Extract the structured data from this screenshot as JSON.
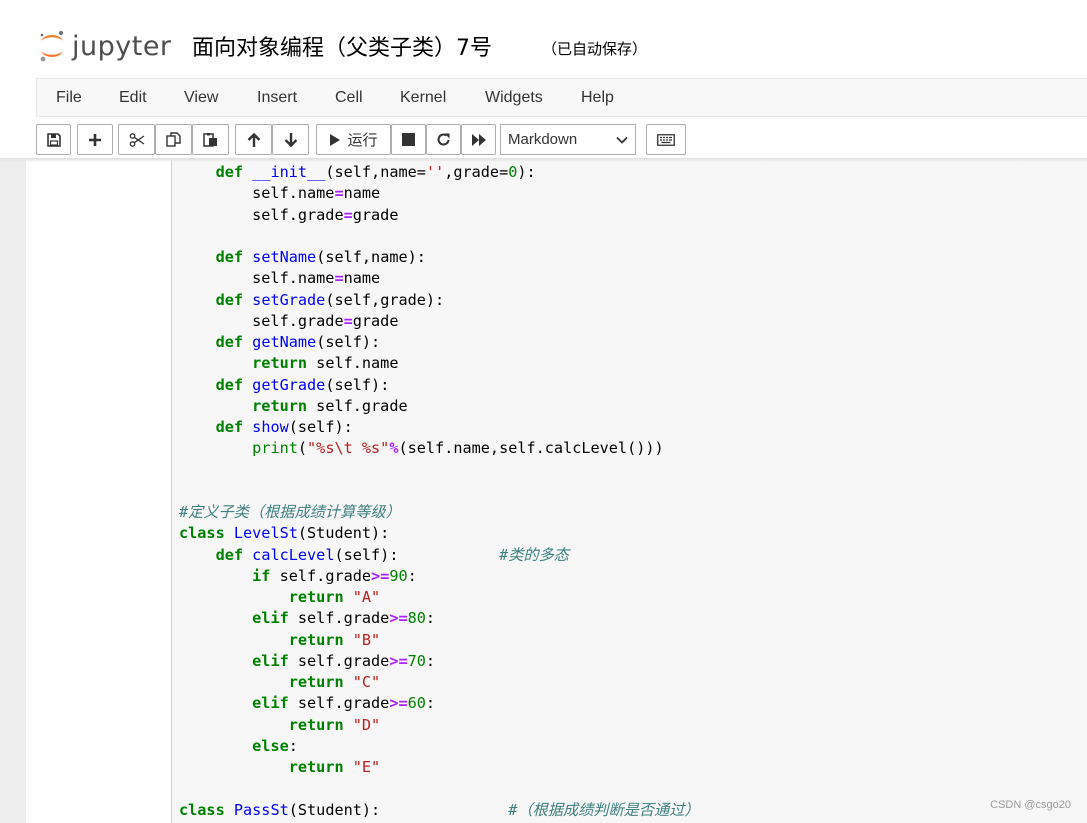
{
  "app": {
    "logo_text": "jupyter",
    "notebook_title": "面向对象编程（父类子类）7号",
    "save_status": "（已自动保存）"
  },
  "menu": [
    "File",
    "Edit",
    "View",
    "Insert",
    "Cell",
    "Kernel",
    "Widgets",
    "Help"
  ],
  "toolbar": {
    "run_label": "运行",
    "cell_type": "Markdown",
    "buttons": [
      "save-icon",
      "plus-icon",
      "cut-icon",
      "copy-icon",
      "paste-icon",
      "arrow-up-icon",
      "arrow-down-icon",
      "play-icon",
      "stop-icon",
      "restart-icon",
      "fast-forward-icon",
      "keyboard-icon"
    ]
  },
  "colors": {
    "logo_orange": "#f37626",
    "keyword": "#008000",
    "function_name": "#0000ff",
    "operator": "#aa22ff",
    "string": "#ba2121",
    "comment": "#408080"
  },
  "code": [
    [
      [
        "    ",
        ""
      ],
      [
        "def",
        "kw"
      ],
      [
        " ",
        ""
      ],
      [
        "__init__",
        "def"
      ],
      [
        "(self,name=",
        ""
      ],
      [
        "''",
        "str"
      ],
      [
        ",grade=",
        ""
      ],
      [
        "0",
        "num"
      ],
      [
        "):",
        ""
      ]
    ],
    [
      [
        "        self.name",
        ""
      ],
      [
        "=",
        "op"
      ],
      [
        "name",
        ""
      ]
    ],
    [
      [
        "        self.grade",
        ""
      ],
      [
        "=",
        "op"
      ],
      [
        "grade",
        ""
      ]
    ],
    [],
    [
      [
        "    ",
        ""
      ],
      [
        "def",
        "kw"
      ],
      [
        " ",
        ""
      ],
      [
        "setName",
        "def"
      ],
      [
        "(self,name):",
        ""
      ]
    ],
    [
      [
        "        self.name",
        ""
      ],
      [
        "=",
        "op"
      ],
      [
        "name",
        ""
      ]
    ],
    [
      [
        "    ",
        ""
      ],
      [
        "def",
        "kw"
      ],
      [
        " ",
        ""
      ],
      [
        "setGrade",
        "def"
      ],
      [
        "(self,grade):",
        ""
      ]
    ],
    [
      [
        "        self.grade",
        ""
      ],
      [
        "=",
        "op"
      ],
      [
        "grade",
        ""
      ]
    ],
    [
      [
        "    ",
        ""
      ],
      [
        "def",
        "kw"
      ],
      [
        " ",
        ""
      ],
      [
        "getName",
        "def"
      ],
      [
        "(self):",
        ""
      ]
    ],
    [
      [
        "        ",
        ""
      ],
      [
        "return",
        "kw"
      ],
      [
        " self.name",
        ""
      ]
    ],
    [
      [
        "    ",
        ""
      ],
      [
        "def",
        "kw"
      ],
      [
        " ",
        ""
      ],
      [
        "getGrade",
        "def"
      ],
      [
        "(self):",
        ""
      ]
    ],
    [
      [
        "        ",
        ""
      ],
      [
        "return",
        "kw"
      ],
      [
        " self.grade",
        ""
      ]
    ],
    [
      [
        "    ",
        ""
      ],
      [
        "def",
        "kw"
      ],
      [
        " ",
        ""
      ],
      [
        "show",
        "def"
      ],
      [
        "(self):",
        ""
      ]
    ],
    [
      [
        "        ",
        ""
      ],
      [
        "print",
        "bi"
      ],
      [
        "(",
        ""
      ],
      [
        "\"%s\\t %s\"",
        "str"
      ],
      [
        "%",
        "op"
      ],
      [
        "(self.name,self.calcLevel()))",
        ""
      ]
    ],
    [],
    [],
    [
      [
        "#定义子类（根据成绩计算等级）",
        "cm"
      ]
    ],
    [
      [
        "class",
        "kw"
      ],
      [
        " ",
        ""
      ],
      [
        "LevelSt",
        "def"
      ],
      [
        "(Student):",
        ""
      ]
    ],
    [
      [
        "    ",
        ""
      ],
      [
        "def",
        "kw"
      ],
      [
        " ",
        ""
      ],
      [
        "calcLevel",
        "def"
      ],
      [
        "(self):           ",
        ""
      ],
      [
        "#类的多态",
        "cm"
      ]
    ],
    [
      [
        "        ",
        ""
      ],
      [
        "if",
        "kw"
      ],
      [
        " self.grade",
        ""
      ],
      [
        ">=",
        "op"
      ],
      [
        "90",
        "num"
      ],
      [
        ":",
        ""
      ]
    ],
    [
      [
        "            ",
        ""
      ],
      [
        "return",
        "kw"
      ],
      [
        " ",
        ""
      ],
      [
        "\"A\"",
        "str"
      ]
    ],
    [
      [
        "        ",
        ""
      ],
      [
        "elif",
        "kw"
      ],
      [
        " self.grade",
        ""
      ],
      [
        ">=",
        "op"
      ],
      [
        "80",
        "num"
      ],
      [
        ":",
        ""
      ]
    ],
    [
      [
        "            ",
        ""
      ],
      [
        "return",
        "kw"
      ],
      [
        " ",
        ""
      ],
      [
        "\"B\"",
        "str"
      ]
    ],
    [
      [
        "        ",
        ""
      ],
      [
        "elif",
        "kw"
      ],
      [
        " self.grade",
        ""
      ],
      [
        ">=",
        "op"
      ],
      [
        "70",
        "num"
      ],
      [
        ":",
        ""
      ]
    ],
    [
      [
        "            ",
        ""
      ],
      [
        "return",
        "kw"
      ],
      [
        " ",
        ""
      ],
      [
        "\"C\"",
        "str"
      ]
    ],
    [
      [
        "        ",
        ""
      ],
      [
        "elif",
        "kw"
      ],
      [
        " self.grade",
        ""
      ],
      [
        ">=",
        "op"
      ],
      [
        "60",
        "num"
      ],
      [
        ":",
        ""
      ]
    ],
    [
      [
        "            ",
        ""
      ],
      [
        "return",
        "kw"
      ],
      [
        " ",
        ""
      ],
      [
        "\"D\"",
        "str"
      ]
    ],
    [
      [
        "        ",
        ""
      ],
      [
        "else",
        "kw"
      ],
      [
        ":",
        ""
      ]
    ],
    [
      [
        "            ",
        ""
      ],
      [
        "return",
        "kw"
      ],
      [
        " ",
        ""
      ],
      [
        "\"E\"",
        "str"
      ]
    ],
    [],
    [
      [
        "class",
        "kw"
      ],
      [
        " ",
        ""
      ],
      [
        "PassSt",
        "def"
      ],
      [
        "(Student):              ",
        ""
      ],
      [
        "#（根据成绩判断是否通过）",
        "cm"
      ]
    ]
  ],
  "watermark": "CSDN @csgo20"
}
